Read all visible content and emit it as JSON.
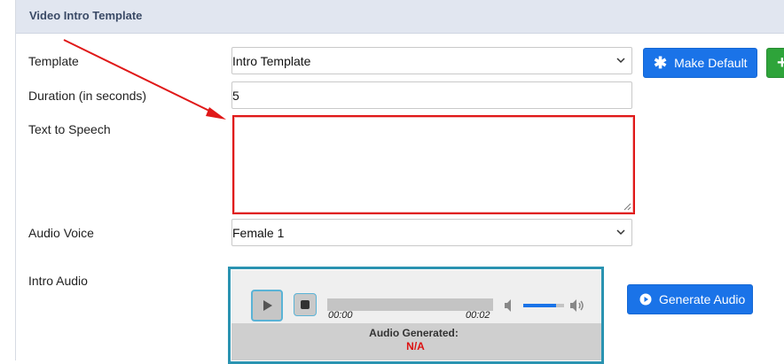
{
  "panel": {
    "title": "Video Intro Template"
  },
  "form": {
    "template_label": "Template",
    "template_value": "Intro Template",
    "duration_label": "Duration (in seconds)",
    "duration_value": "5",
    "tts_label": "Text to Speech",
    "tts_value": "",
    "voice_label": "Audio Voice",
    "voice_value": "Female 1",
    "intro_audio_label": "Intro Audio"
  },
  "buttons": {
    "make_default": "Make Default",
    "add": "+",
    "generate_audio": "Generate Audio"
  },
  "player": {
    "current_time": "00:00",
    "duration": "00:02",
    "volume_fraction": 0.8,
    "generated_label": "Audio Generated:",
    "generated_value": "N/A"
  },
  "colors": {
    "annotation": "#e01818",
    "primary": "#1a73e8",
    "success": "#2ea43a",
    "player_border": "#2a93b1"
  }
}
